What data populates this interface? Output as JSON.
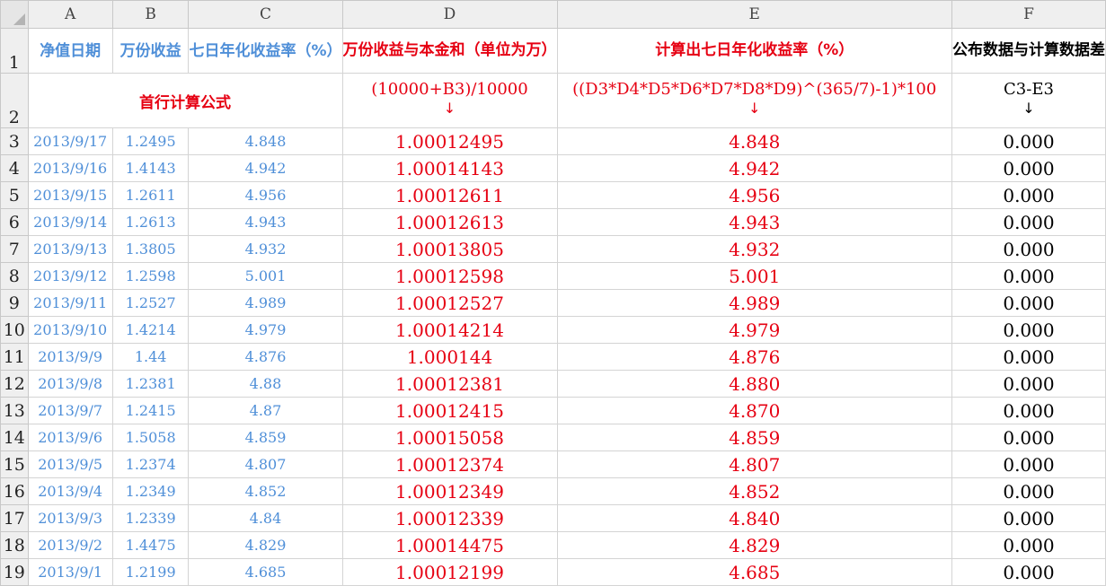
{
  "columns": [
    "A",
    "B",
    "C",
    "D",
    "E",
    "F"
  ],
  "row1": {
    "num": "1",
    "a": "净值日期",
    "b": "万份收益",
    "c": "七日年化收益率（%）",
    "d": "万份收益与本金和（单位为万）",
    "e": "计算出七日年化收益率（%）",
    "f": "公布数据与计算数据差"
  },
  "row2": {
    "num": "2",
    "label": "首行计算公式",
    "d_formula": "(10000+B3)/10000",
    "e_formula": "((D3*D4*D5*D6*D7*D8*D9)^(365/7)-1)*100",
    "f_formula": "C3-E3",
    "arrow": "↓"
  },
  "rows": [
    {
      "num": "3",
      "date": "2013/9/17",
      "b": "1.2495",
      "c": "4.848",
      "d": "1.00012495",
      "e": "4.848",
      "f": "0.000"
    },
    {
      "num": "4",
      "date": "2013/9/16",
      "b": "1.4143",
      "c": "4.942",
      "d": "1.00014143",
      "e": "4.942",
      "f": "0.000"
    },
    {
      "num": "5",
      "date": "2013/9/15",
      "b": "1.2611",
      "c": "4.956",
      "d": "1.00012611",
      "e": "4.956",
      "f": "0.000"
    },
    {
      "num": "6",
      "date": "2013/9/14",
      "b": "1.2613",
      "c": "4.943",
      "d": "1.00012613",
      "e": "4.943",
      "f": "0.000"
    },
    {
      "num": "7",
      "date": "2013/9/13",
      "b": "1.3805",
      "c": "4.932",
      "d": "1.00013805",
      "e": "4.932",
      "f": "0.000"
    },
    {
      "num": "8",
      "date": "2013/9/12",
      "b": "1.2598",
      "c": "5.001",
      "d": "1.00012598",
      "e": "5.001",
      "f": "0.000"
    },
    {
      "num": "9",
      "date": "2013/9/11",
      "b": "1.2527",
      "c": "4.989",
      "d": "1.00012527",
      "e": "4.989",
      "f": "0.000"
    },
    {
      "num": "10",
      "date": "2013/9/10",
      "b": "1.4214",
      "c": "4.979",
      "d": "1.00014214",
      "e": "4.979",
      "f": "0.000"
    },
    {
      "num": "11",
      "date": "2013/9/9",
      "b": "1.44",
      "c": "4.876",
      "d": "1.000144",
      "e": "4.876",
      "f": "0.000"
    },
    {
      "num": "12",
      "date": "2013/9/8",
      "b": "1.2381",
      "c": "4.88",
      "d": "1.00012381",
      "e": "4.880",
      "f": "0.000"
    },
    {
      "num": "13",
      "date": "2013/9/7",
      "b": "1.2415",
      "c": "4.87",
      "d": "1.00012415",
      "e": "4.870",
      "f": "0.000"
    },
    {
      "num": "14",
      "date": "2013/9/6",
      "b": "1.5058",
      "c": "4.859",
      "d": "1.00015058",
      "e": "4.859",
      "f": "0.000"
    },
    {
      "num": "15",
      "date": "2013/9/5",
      "b": "1.2374",
      "c": "4.807",
      "d": "1.00012374",
      "e": "4.807",
      "f": "0.000"
    },
    {
      "num": "16",
      "date": "2013/9/4",
      "b": "1.2349",
      "c": "4.852",
      "d": "1.00012349",
      "e": "4.852",
      "f": "0.000"
    },
    {
      "num": "17",
      "date": "2013/9/3",
      "b": "1.2339",
      "c": "4.84",
      "d": "1.00012339",
      "e": "4.840",
      "f": "0.000"
    },
    {
      "num": "18",
      "date": "2013/9/2",
      "b": "1.4475",
      "c": "4.829",
      "d": "1.00014475",
      "e": "4.829",
      "f": "0.000"
    },
    {
      "num": "19",
      "date": "2013/9/1",
      "b": "1.2199",
      "c": "4.685",
      "d": "1.00012199",
      "e": "4.685",
      "f": "0.000"
    }
  ],
  "colors": {
    "header_blue": "#4f8fd8",
    "formula_red": "#e60012",
    "text_black": "#000000",
    "header_bg": "#efefef"
  }
}
